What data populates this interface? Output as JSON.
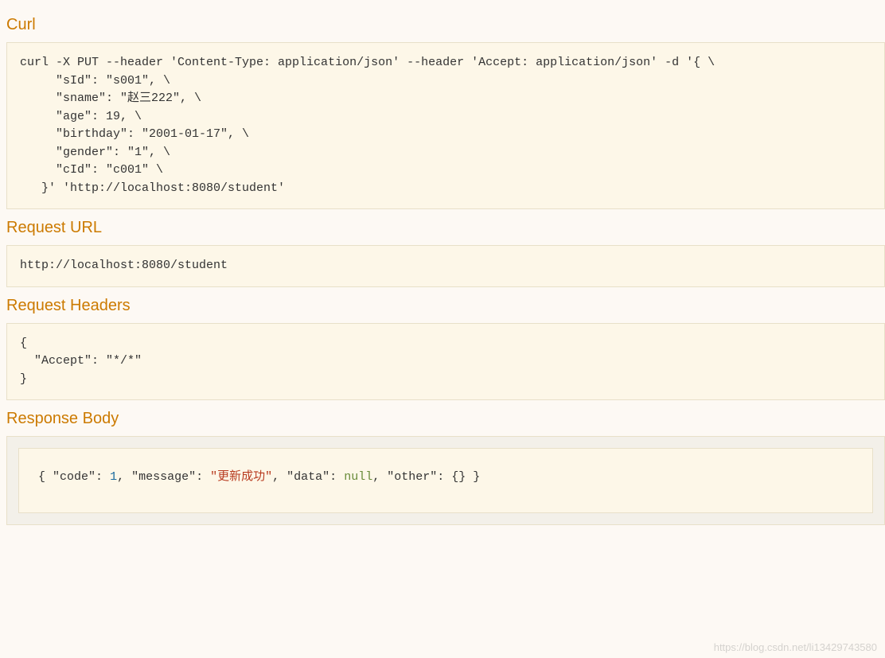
{
  "sections": {
    "curl": {
      "title": "Curl",
      "content": "curl -X PUT --header 'Content-Type: application/json' --header 'Accept: application/json' -d '{ \\ \n     \"sId\": \"s001\", \\ \n     \"sname\": \"赵三222\", \\ \n     \"age\": 19, \\ \n     \"birthday\": \"2001-01-17\", \\ \n     \"gender\": \"1\", \\ \n     \"cId\": \"c001\" \\ \n   }' 'http://localhost:8080/student'"
    },
    "request_url": {
      "title": "Request URL",
      "content": "http://localhost:8080/student"
    },
    "request_headers": {
      "title": "Request Headers",
      "content": "{\n  \"Accept\": \"*/*\"\n}"
    },
    "response_body": {
      "title": "Response Body",
      "json": {
        "open": "{",
        "code_key": "\"code\"",
        "code_val": "1",
        "message_key": "\"message\"",
        "message_val": "\"更新成功\"",
        "data_key": "\"data\"",
        "data_val": "null",
        "other_key": "\"other\"",
        "other_val": "{}",
        "close": "}"
      },
      "data_object": {
        "code": 1,
        "message": "更新成功",
        "data": null,
        "other": {}
      }
    }
  },
  "watermark": "https://blog.csdn.net/li13429743580"
}
